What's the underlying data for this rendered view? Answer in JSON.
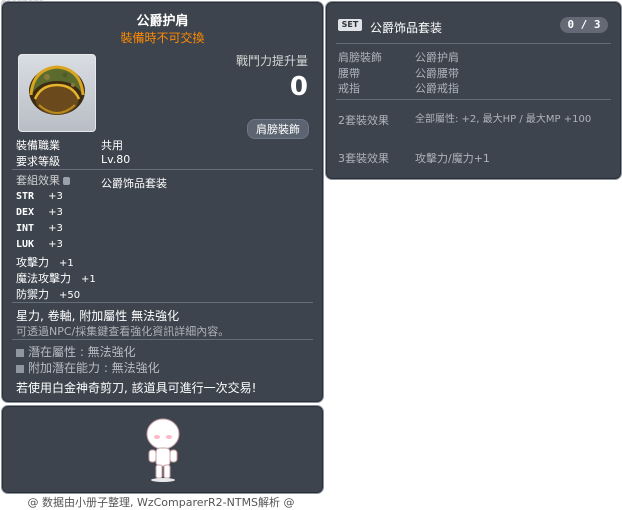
{
  "item": {
    "id": "01152081",
    "name": "公爵护肩",
    "trade_note": "裝備時不可交換",
    "icon": "epaulet-icon",
    "combat_power_label": "戰鬥力提升量",
    "combat_power_value": "0",
    "slot": "肩膀裝飾",
    "job_label": "裝備職業",
    "job_value": "共用",
    "level_label": "要求等級",
    "level_value": "Lv.80",
    "set_label": "套組效果",
    "set_name": "公爵饰品套装",
    "stats": [
      {
        "name": "STR",
        "value": "+3"
      },
      {
        "name": "DEX",
        "value": "+3"
      },
      {
        "name": "INT",
        "value": "+3"
      },
      {
        "name": "LUK",
        "value": "+3"
      }
    ],
    "stats2": [
      {
        "name": "攻擊力",
        "value": "+1"
      },
      {
        "name": "魔法攻擊力",
        "value": "+1"
      },
      {
        "name": "防禦力",
        "value": "+50"
      }
    ],
    "flags": "星力, 卷軸, 附加屬性 無法強化",
    "flags_note": "可透過NPC/採集鍵查看強化資訊詳細內容。",
    "potential": "潛在屬性 : 無法強化",
    "additional_potential": "附加潛在能力 : 無法強化",
    "scissors_note": "若使用白金神奇剪刀, 該道具可進行一次交易!"
  },
  "set_panel": {
    "badge": "SET",
    "title": "公爵饰品套装",
    "count": "0 / 3",
    "parts": [
      {
        "slot": "肩膀裝飾",
        "name": "公爵护肩"
      },
      {
        "slot": "腰帶",
        "name": "公爵腰带"
      },
      {
        "slot": "戒指",
        "name": "公爵戒指"
      }
    ],
    "effects": [
      {
        "label": "2套裝效果",
        "text": "全部屬性: +2, 最大HP / 最大MP  +100"
      },
      {
        "label": "3套裝效果",
        "text": "攻擊力/魔力+1"
      }
    ]
  },
  "footer": "@ 数据由小册子整理, WzComparerR2-NTMS解析 @",
  "colors": {
    "panel_bg": "#3e444d",
    "trade_note": "#ff8a00",
    "muted": "#aeb3ba"
  }
}
